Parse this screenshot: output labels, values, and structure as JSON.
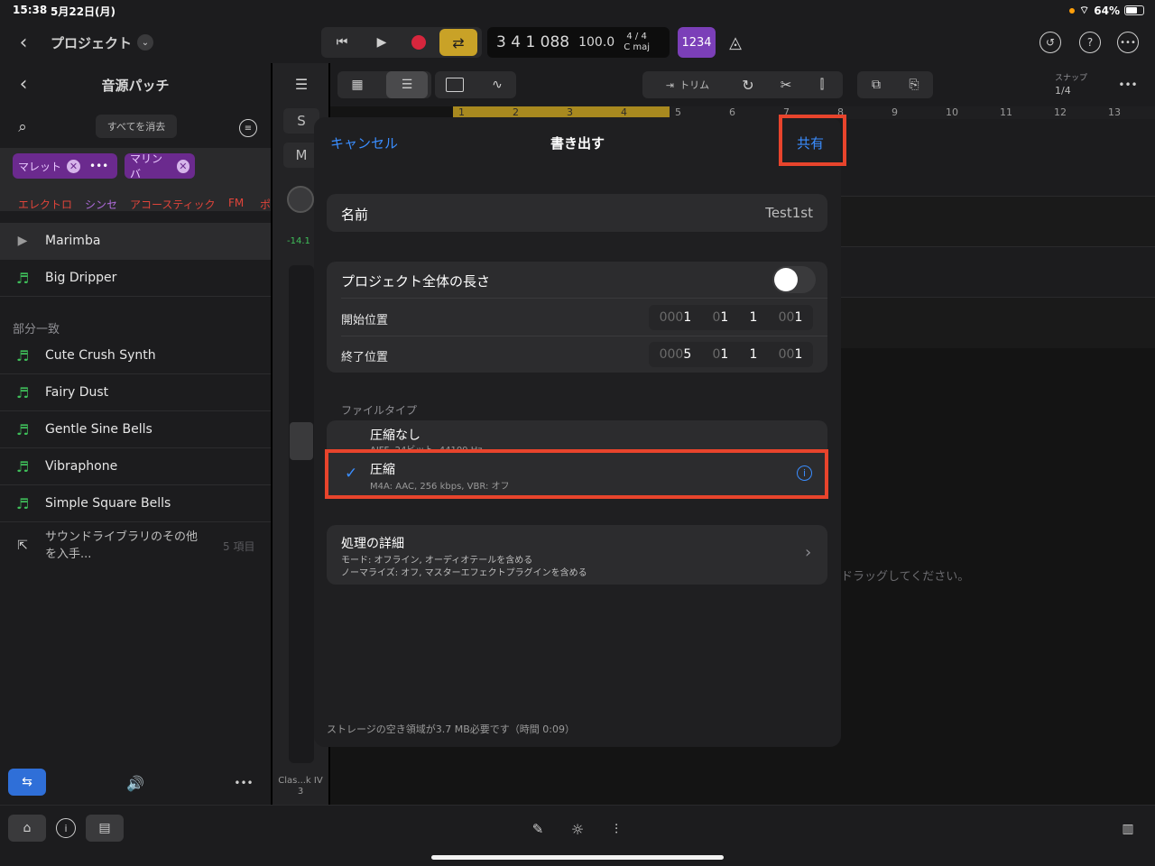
{
  "status_bar": {
    "time": "15:38",
    "date": "5月22日(月)",
    "battery": "64%"
  },
  "top_bar": {
    "back_label": "プロジェクト",
    "lcd_position": "3 4 1 088",
    "tempo": "100.0",
    "time_signature": "4 / 4",
    "key": "C maj",
    "count_in": "1234"
  },
  "arrange_tools": {
    "trim_label": "トリム",
    "snap_label": "スナップ",
    "snap_value": "1/4"
  },
  "ruler": {
    "marks": [
      "1",
      "2",
      "3",
      "4",
      "5",
      "6",
      "7",
      "8",
      "9",
      "10",
      "11",
      "12",
      "13"
    ]
  },
  "library": {
    "title": "音源パッチ",
    "clear_all": "すべてを消去",
    "tags": [
      {
        "label": "マレット"
      },
      {
        "label": "マリンバ"
      }
    ],
    "categories": [
      "エレクトロ",
      "シンセ",
      "アコースティック",
      "FM",
      "ポ"
    ],
    "top_items": [
      "Marimba",
      "Big Dripper"
    ],
    "partial_match_header": "部分一致",
    "items": [
      "Cute Crush Synth",
      "Fairy Dust",
      "Gentle Sine Bells",
      "Vibraphone",
      "Simple Square Bells"
    ],
    "more_line1": "サウンドライブラリのその他",
    "more_line2": "を入手...",
    "more_count": "5 項目"
  },
  "strip": {
    "solo": "S",
    "mute": "M",
    "level": "-14.1",
    "track_name": "Clas...k IV",
    "track_number": "3"
  },
  "arrange_hint": "ドラッグしてください。",
  "dialog": {
    "cancel": "キャンセル",
    "title": "書き出す",
    "share": "共有",
    "name_label": "名前",
    "name_value": "Test1st",
    "full_length_label": "プロジェクト全体の長さ",
    "start_label": "開始位置",
    "start_value": {
      "bar_dim": "000",
      "bar": "1",
      "beat_dim": "0",
      "beat": "1",
      "div": "1",
      "tick_dim": "00",
      "tick": "1"
    },
    "end_label": "終了位置",
    "end_value": {
      "bar_dim": "000",
      "bar": "5",
      "beat_dim": "0",
      "beat": "1",
      "div": "1",
      "tick_dim": "00",
      "tick": "1"
    },
    "file_type_header": "ファイルタイプ",
    "uncompressed_label": "圧縮なし",
    "uncompressed_detail": "AIFF, 24ビット, 44100 Hz",
    "compressed_label": "圧縮",
    "compressed_detail": "M4A: AAC, 256 kbps, VBR: オフ",
    "processing_label": "処理の詳細",
    "processing_line1": "モード: オフライン, オーディオテールを含める",
    "processing_line2": "ノーマライズ: オフ, マスターエフェクトプラグインを含める",
    "storage_note": "ストレージの空き領域が3.7 MB必要です（時間 0:09）"
  }
}
